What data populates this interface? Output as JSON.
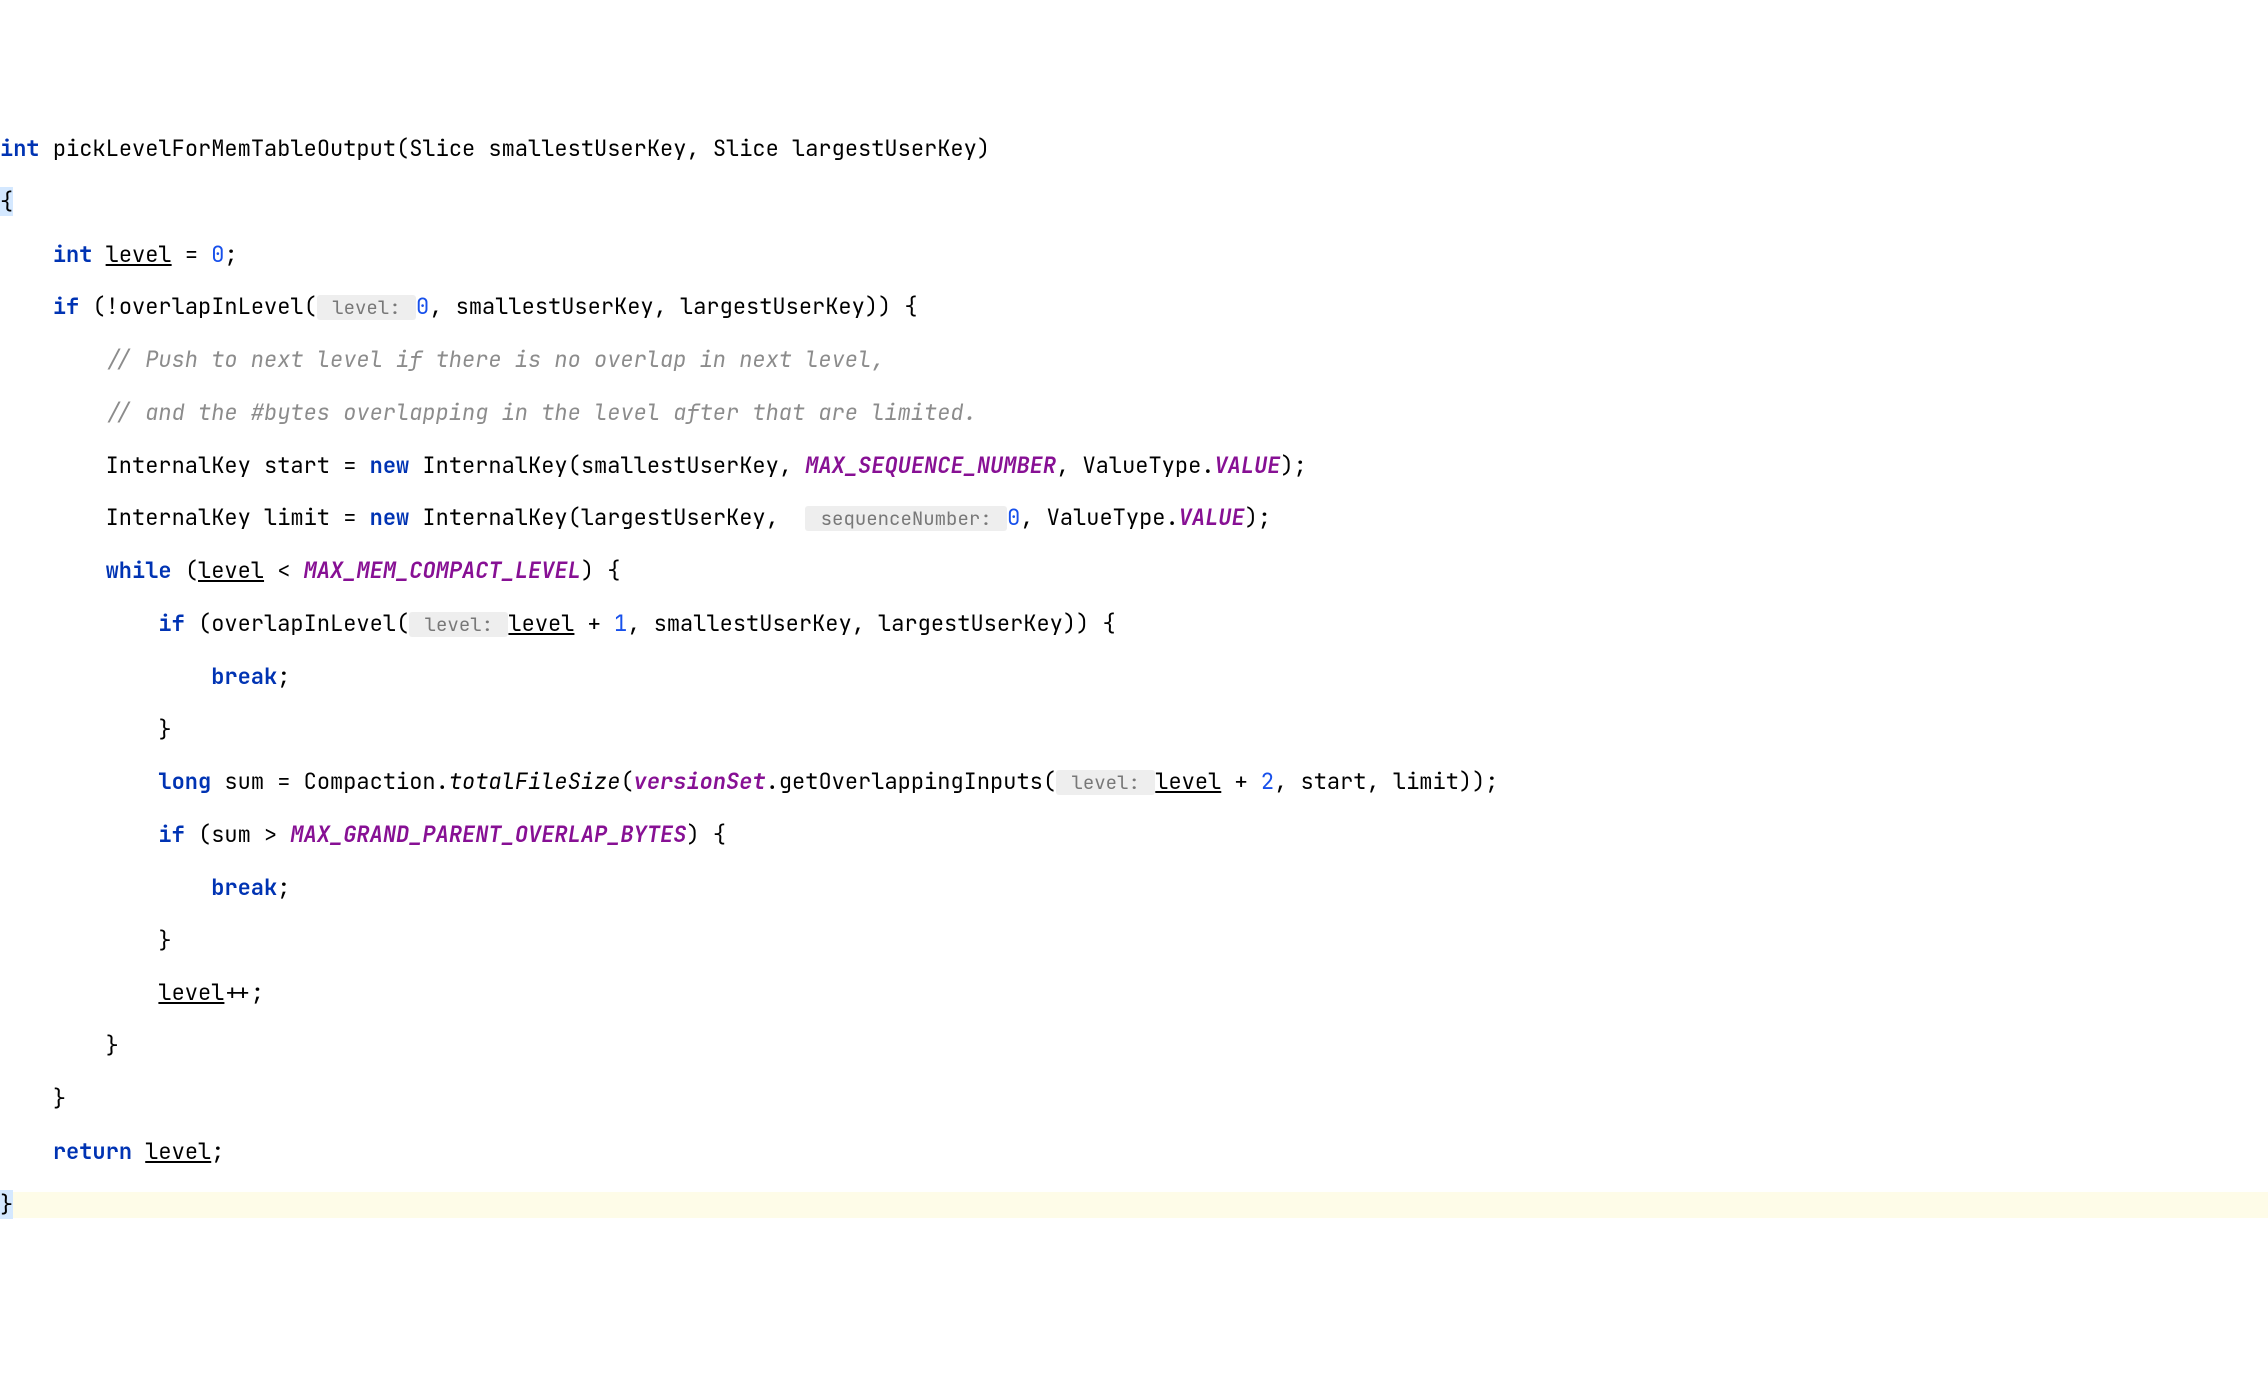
{
  "lines": {
    "l1": {
      "kw1": "int",
      "method": "pickLevelForMemTableOutput",
      "p1": "(Slice smallestUserKey, Slice largestUserKey)"
    },
    "l2": {
      "brace": "{"
    },
    "l3": {
      "kw1": "int",
      "var": "level",
      "eq": " = ",
      "num": "0",
      "semi": ";"
    },
    "l4": {
      "kw1": "if",
      "pre": " (!overlapInLevel(",
      "hint": " level: ",
      "num": "0",
      "post": ", smallestUserKey, largestUserKey)) {"
    },
    "l5": {
      "comment": "// Push to next level if there is no overlap in next level,"
    },
    "l6": {
      "comment": "// and the #bytes overlapping in the level after that are limited."
    },
    "l7": {
      "pre": "InternalKey start = ",
      "kw": "new",
      "mid": " InternalKey(smallestUserKey, ",
      "const": "MAX_SEQUENCE_NUMBER",
      "mid2": ", ValueType.",
      "val": "VALUE",
      "post": ");"
    },
    "l8": {
      "pre": "InternalKey limit = ",
      "kw": "new",
      "mid": " InternalKey(largestUserKey, ",
      "hint": " sequenceNumber: ",
      "num": "0",
      "mid2": ", ValueType.",
      "val": "VALUE",
      "post": ");"
    },
    "l9": {
      "kw": "while",
      "pre": " (",
      "var": "level",
      "mid": " < ",
      "const": "MAX_MEM_COMPACT_LEVEL",
      "post": ") {"
    },
    "l10": {
      "kw": "if",
      "pre": " (overlapInLevel(",
      "hint": " level: ",
      "var": "level",
      "mid": " + ",
      "num": "1",
      "post": ", smallestUserKey, largestUserKey)) {"
    },
    "l11": {
      "kw": "break",
      "semi": ";"
    },
    "l12": {
      "brace": "}"
    },
    "l13": {
      "kw": "long",
      "pre": " sum = Compaction.",
      "method": "totalFileSize",
      "mid": "(",
      "field": "versionSet",
      "mid2": ".getOverlappingInputs(",
      "hint": " level: ",
      "var": "level",
      "mid3": " + ",
      "num": "2",
      "post": ", start, limit));"
    },
    "l14": {
      "kw": "if",
      "pre": " (sum > ",
      "const": "MAX_GRAND_PARENT_OVERLAP_BYTES",
      "post": ") {"
    },
    "l15": {
      "kw": "break",
      "semi": ";"
    },
    "l16": {
      "brace": "}"
    },
    "l17": {
      "var": "level",
      "post": "++;"
    },
    "l18": {
      "brace": "}"
    },
    "l19": {
      "brace": "}"
    },
    "l20": {
      "kw": "return",
      "sp": " ",
      "var": "level",
      "semi": ";"
    },
    "l21": {
      "brace": "}"
    }
  }
}
